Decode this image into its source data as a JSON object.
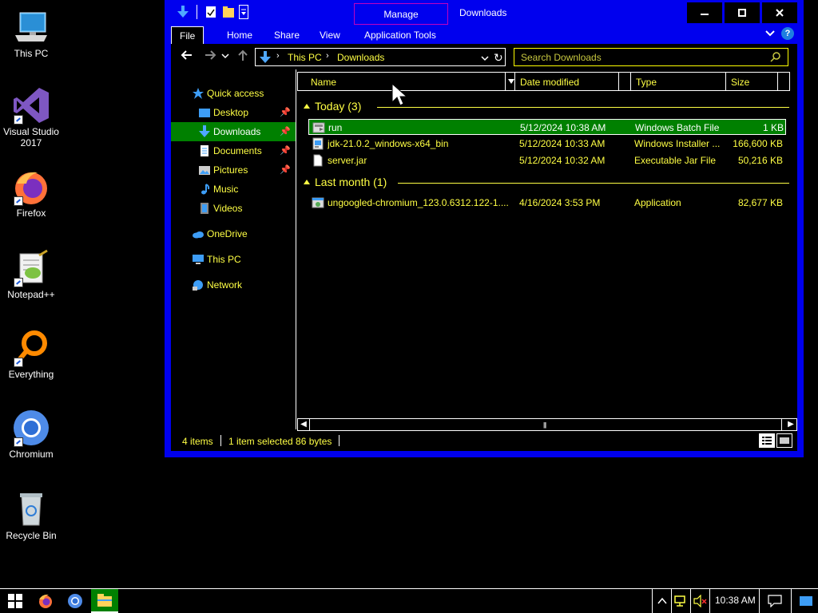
{
  "desktop": {
    "icons": [
      {
        "label": "This PC"
      },
      {
        "label": "Visual Studio\n2017"
      },
      {
        "label": "Firefox"
      },
      {
        "label": "Notepad++"
      },
      {
        "label": "Everything"
      },
      {
        "label": "Chromium"
      },
      {
        "label": "Recycle Bin"
      }
    ]
  },
  "window": {
    "title": "Downloads",
    "manage_tab": "Manage",
    "controls": {
      "minimize": "–",
      "maximize": "☐",
      "close": "✕"
    },
    "ribbon_tabs": [
      "File",
      "Home",
      "Share",
      "View",
      "Application Tools"
    ],
    "address": {
      "root": "This PC",
      "current": "Downloads"
    },
    "search_placeholder": "Search Downloads",
    "nav": [
      {
        "label": "Quick access"
      },
      {
        "label": "Desktop"
      },
      {
        "label": "Downloads"
      },
      {
        "label": "Documents"
      },
      {
        "label": "Pictures"
      },
      {
        "label": "Music"
      },
      {
        "label": "Videos"
      },
      {
        "label": "OneDrive"
      },
      {
        "label": "This PC"
      },
      {
        "label": "Network"
      }
    ],
    "columns": [
      "Name",
      "Date modified",
      "Type",
      "Size"
    ],
    "groups": [
      {
        "label": "Today (3)",
        "files": [
          {
            "name": "run",
            "date": "5/12/2024 10:38 AM",
            "type": "Windows Batch File",
            "size": "1 KB"
          },
          {
            "name": "jdk-21.0.2_windows-x64_bin",
            "date": "5/12/2024 10:33 AM",
            "type": "Windows Installer ...",
            "size": "166,600 KB"
          },
          {
            "name": "server.jar",
            "date": "5/12/2024 10:32 AM",
            "type": "Executable Jar File",
            "size": "50,216 KB"
          }
        ]
      },
      {
        "label": "Last month (1)",
        "files": [
          {
            "name": "ungoogled-chromium_123.0.6312.122-1....",
            "date": "4/16/2024 3:53 PM",
            "type": "Application",
            "size": "82,677 KB"
          }
        ]
      }
    ],
    "status": {
      "items": "4 items",
      "selected": "1 item selected  86 bytes"
    }
  },
  "taskbar": {
    "clock": "10:38 AM"
  },
  "colors": {
    "window_frame": "#0000ee",
    "text_yellow": "#ffff44",
    "selection_green": "#008000",
    "manage_border": "#c000c0"
  }
}
